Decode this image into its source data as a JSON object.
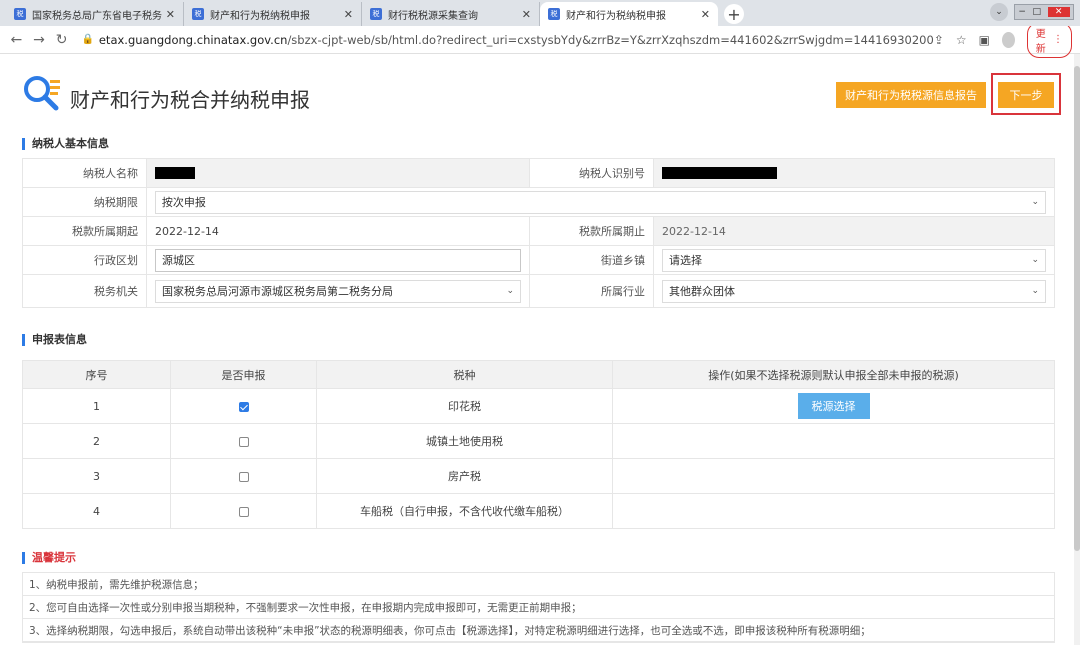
{
  "browser": {
    "tabs": [
      {
        "label": "国家税务总局广东省电子税务局",
        "active": false
      },
      {
        "label": "财产和行为税纳税申报",
        "active": false
      },
      {
        "label": "财行税税源采集查询",
        "active": false
      },
      {
        "label": "财产和行为税纳税申报",
        "active": true
      }
    ],
    "url_host": "etax.guangdong.chinatax.gov.cn",
    "url_path": "/sbzx-cjpt-web/sb/html.do?redirect_uri=cxstysbYdy&zrrBz=Y&zrrXzqhszdm=441602&zrrSwjgdm=14416930200",
    "update_label": "更新"
  },
  "header": {
    "title": "财产和行为税合并纳税申报",
    "report_button": "财产和行为税税源信息报告",
    "next_button": "下一步"
  },
  "basic_info": {
    "section_title": "纳税人基本信息",
    "taxpayer_name_label": "纳税人名称",
    "taxpayer_id_label": "纳税人识别号",
    "period_label": "纳税期限",
    "period_value": "按次申报",
    "start_label": "税款所属期起",
    "start_value": "2022-12-14",
    "end_label": "税款所属期止",
    "end_value": "2022-12-14",
    "district_label": "行政区划",
    "district_value": "源城区",
    "street_label": "街道乡镇",
    "street_value": "请选择",
    "authority_label": "税务机关",
    "authority_value": "国家税务总局河源市源城区税务局第二税务分局",
    "industry_label": "所属行业",
    "industry_value": "其他群众团体"
  },
  "declaration": {
    "section_title": "申报表信息",
    "headers": [
      "序号",
      "是否申报",
      "税种",
      "操作(如果不选择税源则默认申报全部未申报的税源)"
    ],
    "rows": [
      {
        "no": "1",
        "checked": true,
        "tax": "印花税",
        "action": "税源选择"
      },
      {
        "no": "2",
        "checked": false,
        "tax": "城镇土地使用税",
        "action": ""
      },
      {
        "no": "3",
        "checked": false,
        "tax": "房产税",
        "action": ""
      },
      {
        "no": "4",
        "checked": false,
        "tax": "车船税（自行申报，不含代收代缴车船税）",
        "action": ""
      }
    ]
  },
  "tips": {
    "section_title": "温馨提示",
    "items": [
      "1、纳税申报前，需先维护税源信息；",
      "2、您可自由选择一次性或分别申报当期税种，不强制要求一次性申报，在申报期内完成申报即可，无需更正前期申报；",
      "3、选择纳税期限，勾选申报后，系统自动带出该税种“未申报”状态的税源明细表，你可点击【税源选择】，对特定税源明细进行选择，也可全选或不选，即申报该税种所有税源明细；"
    ]
  },
  "colors": {
    "accent": "#2d7be5",
    "orange": "#f5a623",
    "highlight": "#d9343b"
  }
}
